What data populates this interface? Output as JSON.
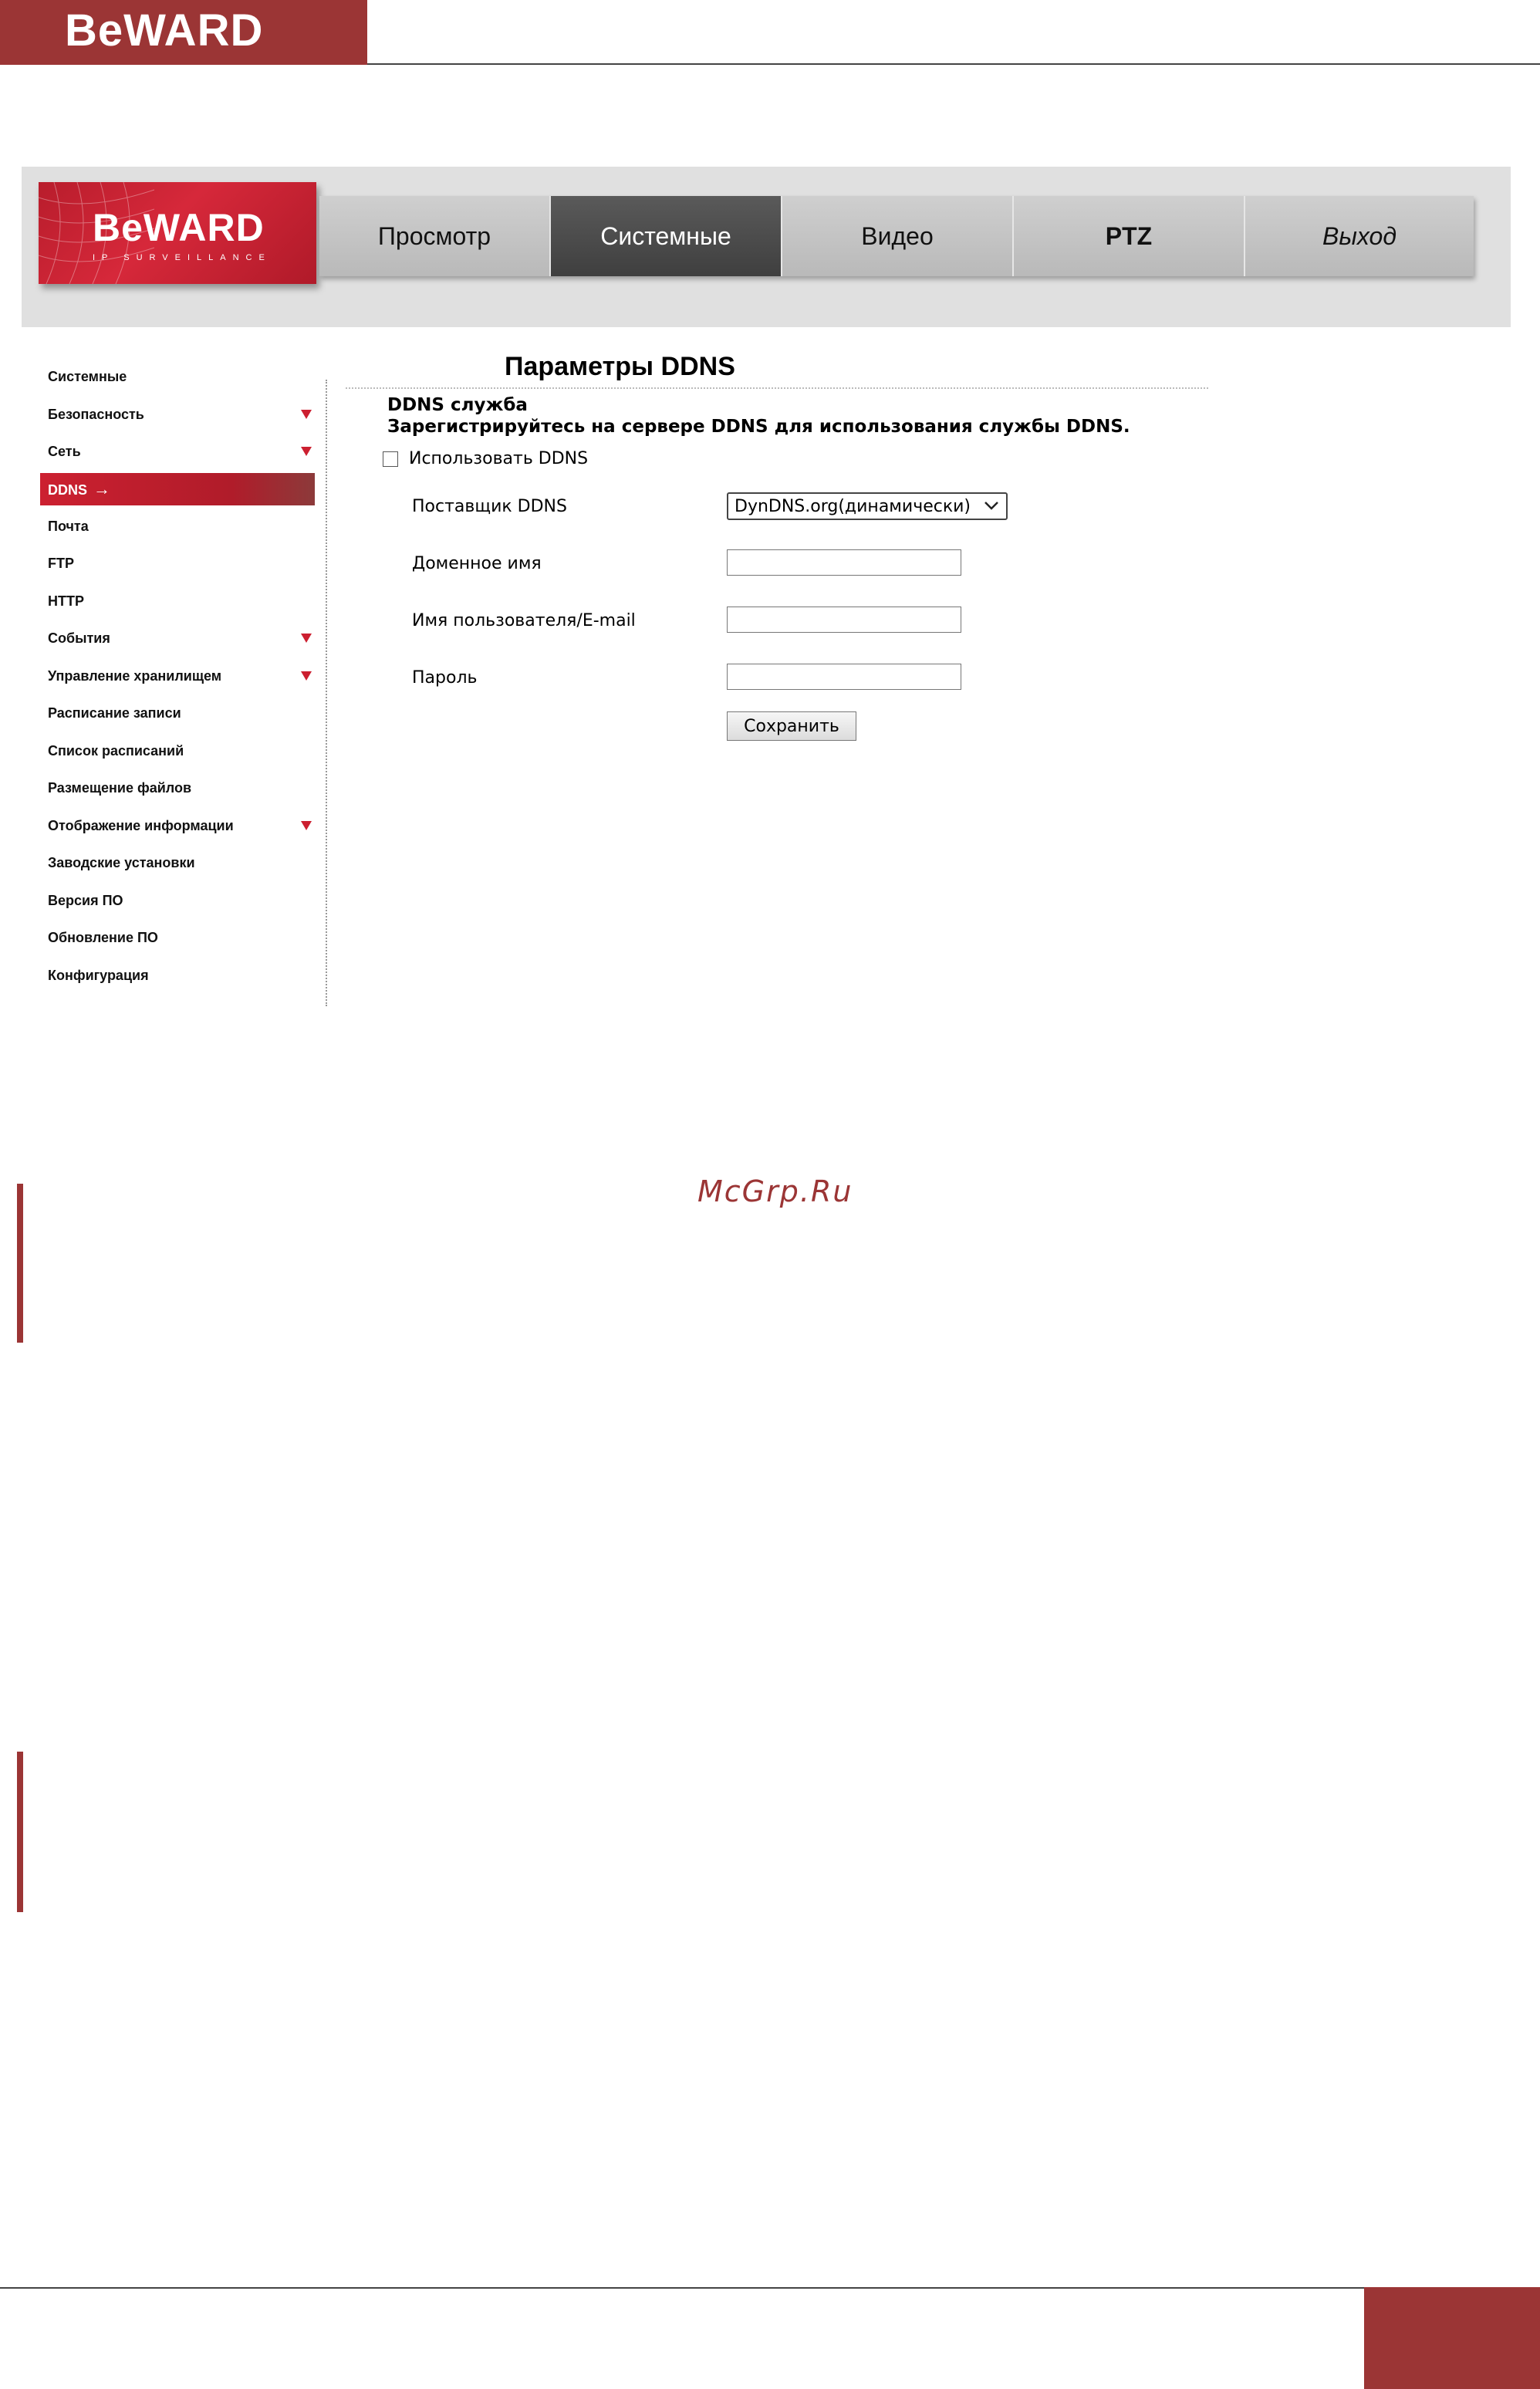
{
  "page_header": {
    "logo_text": "BeWARD"
  },
  "app": {
    "logo_text": "BeWARD",
    "logo_subtitle": "IP SURVEILLANCE",
    "nav_tabs": [
      {
        "label": "Просмотр"
      },
      {
        "label": "Системные"
      },
      {
        "label": "Видео"
      },
      {
        "label": "PTZ"
      },
      {
        "label": "Выход"
      }
    ],
    "active_tab": "Системные",
    "sidebar": {
      "items": [
        {
          "label": "Системные"
        },
        {
          "label": "Безопасность"
        },
        {
          "label": "Сеть"
        },
        {
          "label": "DDNS"
        },
        {
          "label": "Почта"
        },
        {
          "label": "FTP"
        },
        {
          "label": "HTTP"
        },
        {
          "label": "События"
        },
        {
          "label": "Управление хранилищем"
        },
        {
          "label": "Расписание записи"
        },
        {
          "label": "Список расписаний"
        },
        {
          "label": "Размещение файлов"
        },
        {
          "label": "Отображение информации"
        },
        {
          "label": "Заводские установки"
        },
        {
          "label": "Версия ПО"
        },
        {
          "label": "Обновление ПО"
        },
        {
          "label": "Конфигурация"
        }
      ],
      "active_item": "DDNS",
      "expandable_items": [
        "Безопасность",
        "Сеть",
        "События",
        "Управление хранилищем",
        "Отображение информации"
      ]
    },
    "content": {
      "title": "Параметры DDNS",
      "service_heading": "DDNS служба",
      "service_description": "Зарегистрируйтесь на сервере DDNS для использования службы DDNS.",
      "use_ddns_label": "Использовать DDNS",
      "use_ddns_checked": false,
      "provider_label": "Поставщик DDNS",
      "provider_value": "DynDNS.org(динамически)",
      "domain_label": "Доменное имя",
      "domain_value": "",
      "username_label": "Имя пользователя/E-mail",
      "username_value": "",
      "password_label": "Пароль",
      "password_value": "",
      "save_label": "Сохранить"
    }
  },
  "watermark": "McGrp.Ru",
  "colors": {
    "brand": "#9b3535",
    "accent_red": "#cc1f30",
    "active_tab": "#4a4a4a",
    "nav_bar": "#c4c4c4"
  }
}
